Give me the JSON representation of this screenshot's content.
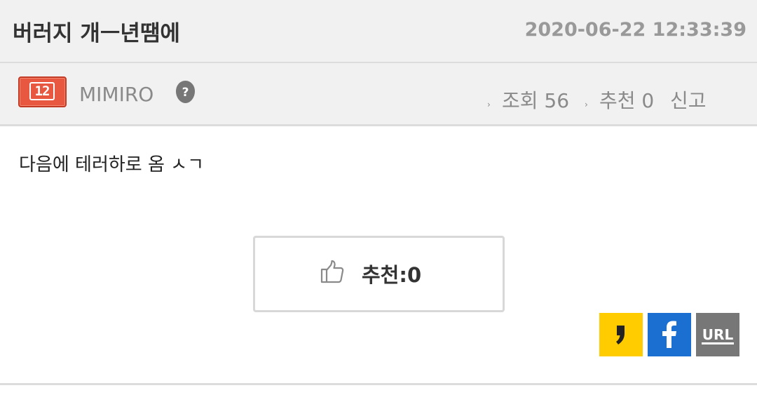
{
  "post": {
    "title": "버러지 개ㅡ년땜에",
    "date": "2020-06-22 12:33:39",
    "content": "다음에 테러하로 옴 ㅅㄱ"
  },
  "author": {
    "level": "12",
    "name": "MIMIRO",
    "icon": "help-icon"
  },
  "stats": {
    "views_label": "조회 56",
    "recommend_label": "추천 0",
    "report_label": "신고"
  },
  "recommend_button": {
    "label": "추천:0",
    "icon": "thumbs-up-icon"
  },
  "share": {
    "kakao_icon": "kakaostory-icon",
    "facebook_icon": "facebook-icon",
    "url_label": "URL"
  },
  "colors": {
    "header_bg": "#f1f1f1",
    "level_badge": "#e8573f",
    "kakao": "#ffcc00",
    "facebook": "#1a6fd0",
    "url": "#777777"
  }
}
